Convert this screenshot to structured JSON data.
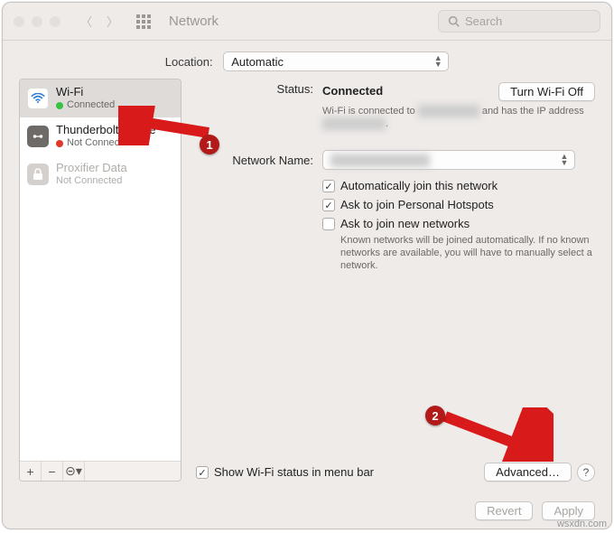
{
  "window": {
    "title": "Network",
    "search_placeholder": "Search",
    "traffic_colors": {
      "close": "#e2e0de",
      "min": "#e2e0de",
      "max": "#e2e0de"
    }
  },
  "location": {
    "label": "Location:",
    "value": "Automatic"
  },
  "services": [
    {
      "name": "Wi-Fi",
      "status": "Connected",
      "dot": "green",
      "selected": true,
      "disabled": false,
      "icon": "wifi-icon"
    },
    {
      "name": "Thunderbolt Bridge",
      "status": "Not Connected",
      "dot": "red",
      "selected": false,
      "disabled": false,
      "icon": "thunderbolt-icon"
    },
    {
      "name": "Proxifier Data",
      "status": "Not Connected",
      "dot": "",
      "selected": false,
      "disabled": true,
      "icon": "lock-icon"
    }
  ],
  "sidebar_buttons": {
    "add": "+",
    "remove": "−",
    "actions": "⊝▾"
  },
  "detail": {
    "status_label": "Status:",
    "status_value": "Connected",
    "toggle_button": "Turn Wi-Fi Off",
    "status_info_prefix": "Wi-Fi is connected to ",
    "status_info_mid": " and has the IP address ",
    "network_name_label": "Network Name:",
    "network_name_value": "████████",
    "auto_join": {
      "checked": true,
      "label": "Automatically join this network"
    },
    "ask_hotspot": {
      "checked": true,
      "label": "Ask to join Personal Hotspots"
    },
    "ask_new": {
      "checked": false,
      "label": "Ask to join new networks",
      "hint": "Known networks will be joined automatically. If no known networks are available, you will have to manually select a network."
    },
    "show_menu": {
      "checked": true,
      "label": "Show Wi-Fi status in menu bar"
    },
    "advanced_button": "Advanced…",
    "help": "?"
  },
  "footer": {
    "revert": "Revert",
    "apply": "Apply"
  },
  "callouts": {
    "one": "1",
    "two": "2"
  },
  "watermark": "wsxdn.com"
}
